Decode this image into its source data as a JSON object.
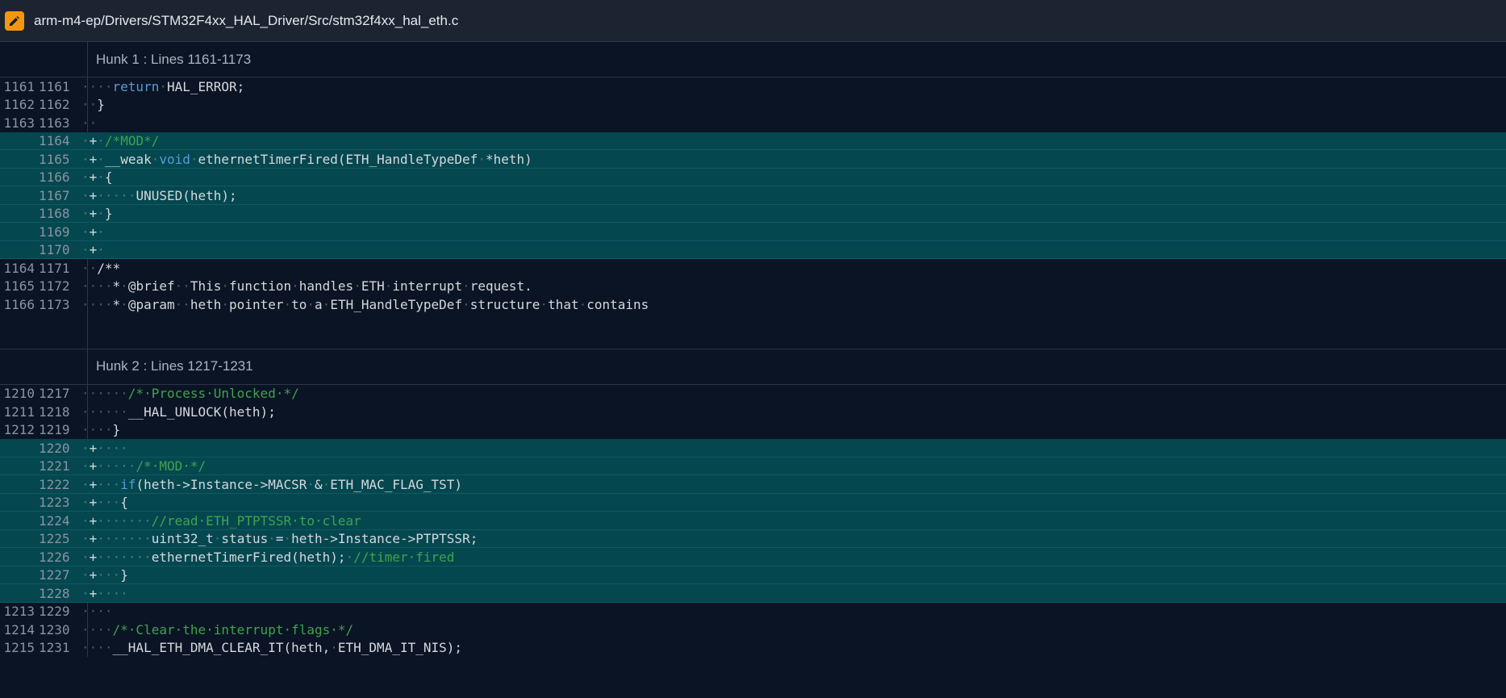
{
  "header": {
    "icon": "pencil-icon",
    "icon_color": "#f4970f",
    "path": "arm-m4-ep/Drivers/STM32F4xx_HAL_Driver/Src/stm32f4xx_hal_eth.c"
  },
  "hunks": [
    {
      "title": "Hunk 1 : Lines 1161-1173",
      "rows": [
        {
          "old": "1161",
          "new": "1161",
          "type": "ctx",
          "segs": [
            [
              "ws",
              "····"
            ],
            [
              "kw",
              "return"
            ],
            [
              "ws",
              "·"
            ],
            [
              "t",
              "HAL_ERROR;"
            ]
          ]
        },
        {
          "old": "1162",
          "new": "1162",
          "type": "ctx",
          "segs": [
            [
              "ws",
              "··"
            ],
            [
              "t",
              "}"
            ]
          ]
        },
        {
          "old": "1163",
          "new": "1163",
          "type": "ctx",
          "segs": [
            [
              "ws",
              "··"
            ]
          ]
        },
        {
          "old": "",
          "new": "1164",
          "type": "add",
          "segs": [
            [
              "ws",
              "·"
            ],
            [
              "t",
              "+"
            ],
            [
              "ws",
              "·"
            ],
            [
              "cm",
              "/*MOD*/"
            ]
          ]
        },
        {
          "old": "",
          "new": "1165",
          "type": "add",
          "segs": [
            [
              "ws",
              "·"
            ],
            [
              "t",
              "+"
            ],
            [
              "ws",
              "·"
            ],
            [
              "t",
              "__weak"
            ],
            [
              "ws",
              "·"
            ],
            [
              "kw",
              "void"
            ],
            [
              "ws",
              "·"
            ],
            [
              "t",
              "ethernetTimerFired(ETH_HandleTypeDef"
            ],
            [
              "ws",
              "·"
            ],
            [
              "t",
              "*heth)"
            ]
          ]
        },
        {
          "old": "",
          "new": "1166",
          "type": "add",
          "segs": [
            [
              "ws",
              "·"
            ],
            [
              "t",
              "+"
            ],
            [
              "ws",
              "·"
            ],
            [
              "t",
              "{"
            ]
          ]
        },
        {
          "old": "",
          "new": "1167",
          "type": "add",
          "segs": [
            [
              "ws",
              "·"
            ],
            [
              "t",
              "+"
            ],
            [
              "ws",
              "·····"
            ],
            [
              "t",
              "UNUSED(heth);"
            ]
          ]
        },
        {
          "old": "",
          "new": "1168",
          "type": "add",
          "segs": [
            [
              "ws",
              "·"
            ],
            [
              "t",
              "+"
            ],
            [
              "ws",
              "·"
            ],
            [
              "t",
              "}"
            ]
          ]
        },
        {
          "old": "",
          "new": "1169",
          "type": "add",
          "segs": [
            [
              "ws",
              "·"
            ],
            [
              "t",
              "+"
            ],
            [
              "ws",
              "·"
            ]
          ]
        },
        {
          "old": "",
          "new": "1170",
          "type": "add",
          "segs": [
            [
              "ws",
              "·"
            ],
            [
              "t",
              "+"
            ],
            [
              "ws",
              "·"
            ]
          ]
        },
        {
          "old": "1164",
          "new": "1171",
          "type": "ctx",
          "segs": [
            [
              "ws",
              "··"
            ],
            [
              "t",
              "/**"
            ]
          ]
        },
        {
          "old": "1165",
          "new": "1172",
          "type": "ctx",
          "segs": [
            [
              "ws",
              "····"
            ],
            [
              "t",
              "*"
            ],
            [
              "ws",
              "·"
            ],
            [
              "t",
              "@brief"
            ],
            [
              "ws",
              "··"
            ],
            [
              "t",
              "This"
            ],
            [
              "ws",
              "·"
            ],
            [
              "t",
              "function"
            ],
            [
              "ws",
              "·"
            ],
            [
              "t",
              "handles"
            ],
            [
              "ws",
              "·"
            ],
            [
              "t",
              "ETH"
            ],
            [
              "ws",
              "·"
            ],
            [
              "t",
              "interrupt"
            ],
            [
              "ws",
              "·"
            ],
            [
              "t",
              "request."
            ]
          ]
        },
        {
          "old": "1166",
          "new": "1173",
          "type": "ctx",
          "segs": [
            [
              "ws",
              "····"
            ],
            [
              "t",
              "*"
            ],
            [
              "ws",
              "·"
            ],
            [
              "t",
              "@param"
            ],
            [
              "ws",
              "··"
            ],
            [
              "t",
              "heth"
            ],
            [
              "ws",
              "·"
            ],
            [
              "t",
              "pointer"
            ],
            [
              "ws",
              "·"
            ],
            [
              "t",
              "to"
            ],
            [
              "ws",
              "·"
            ],
            [
              "t",
              "a"
            ],
            [
              "ws",
              "·"
            ],
            [
              "t",
              "ETH_HandleTypeDef"
            ],
            [
              "ws",
              "·"
            ],
            [
              "t",
              "structure"
            ],
            [
              "ws",
              "·"
            ],
            [
              "t",
              "that"
            ],
            [
              "ws",
              "·"
            ],
            [
              "t",
              "contains"
            ]
          ]
        }
      ]
    },
    {
      "title": "Hunk 2 : Lines 1217-1231",
      "rows": [
        {
          "old": "1210",
          "new": "1217",
          "type": "ctx",
          "segs": [
            [
              "ws",
              "······"
            ],
            [
              "cm",
              "/*·Process·Unlocked·*/"
            ]
          ]
        },
        {
          "old": "1211",
          "new": "1218",
          "type": "ctx",
          "segs": [
            [
              "ws",
              "······"
            ],
            [
              "t",
              "__HAL_UNLOCK(heth);"
            ]
          ]
        },
        {
          "old": "1212",
          "new": "1219",
          "type": "ctx",
          "segs": [
            [
              "ws",
              "····"
            ],
            [
              "t",
              "}"
            ]
          ]
        },
        {
          "old": "",
          "new": "1220",
          "type": "add",
          "segs": [
            [
              "ws",
              "·"
            ],
            [
              "t",
              "+"
            ],
            [
              "ws",
              "····"
            ]
          ]
        },
        {
          "old": "",
          "new": "1221",
          "type": "add",
          "segs": [
            [
              "ws",
              "·"
            ],
            [
              "t",
              "+"
            ],
            [
              "ws",
              "·····"
            ],
            [
              "cm",
              "/*·MOD·*/"
            ]
          ]
        },
        {
          "old": "",
          "new": "1222",
          "type": "add",
          "segs": [
            [
              "ws",
              "·"
            ],
            [
              "t",
              "+"
            ],
            [
              "ws",
              "···"
            ],
            [
              "kw",
              "if"
            ],
            [
              "t",
              "(heth->Instance->MACSR"
            ],
            [
              "ws",
              "·"
            ],
            [
              "t",
              "&"
            ],
            [
              "ws",
              "·"
            ],
            [
              "t",
              "ETH_MAC_FLAG_TST)"
            ]
          ]
        },
        {
          "old": "",
          "new": "1223",
          "type": "add",
          "segs": [
            [
              "ws",
              "·"
            ],
            [
              "t",
              "+"
            ],
            [
              "ws",
              "···"
            ],
            [
              "t",
              "{"
            ]
          ]
        },
        {
          "old": "",
          "new": "1224",
          "type": "add",
          "segs": [
            [
              "ws",
              "·"
            ],
            [
              "t",
              "+"
            ],
            [
              "ws",
              "·······"
            ],
            [
              "cm",
              "//read·ETH_PTPTSSR·to·clear"
            ]
          ]
        },
        {
          "old": "",
          "new": "1225",
          "type": "add",
          "segs": [
            [
              "ws",
              "·"
            ],
            [
              "t",
              "+"
            ],
            [
              "ws",
              "·······"
            ],
            [
              "t",
              "uint32_t"
            ],
            [
              "ws",
              "·"
            ],
            [
              "t",
              "status"
            ],
            [
              "ws",
              "·"
            ],
            [
              "t",
              "="
            ],
            [
              "ws",
              "·"
            ],
            [
              "t",
              "heth->Instance->PTPTSSR;"
            ]
          ]
        },
        {
          "old": "",
          "new": "1226",
          "type": "add",
          "segs": [
            [
              "ws",
              "·"
            ],
            [
              "t",
              "+"
            ],
            [
              "ws",
              "·······"
            ],
            [
              "t",
              "ethernetTimerFired(heth);"
            ],
            [
              "ws",
              "·"
            ],
            [
              "cm",
              "//timer·fired"
            ]
          ]
        },
        {
          "old": "",
          "new": "1227",
          "type": "add",
          "segs": [
            [
              "ws",
              "·"
            ],
            [
              "t",
              "+"
            ],
            [
              "ws",
              "···"
            ],
            [
              "t",
              "}"
            ]
          ]
        },
        {
          "old": "",
          "new": "1228",
          "type": "add",
          "segs": [
            [
              "ws",
              "·"
            ],
            [
              "t",
              "+"
            ],
            [
              "ws",
              "····"
            ]
          ]
        },
        {
          "old": "1213",
          "new": "1229",
          "type": "ctx",
          "segs": [
            [
              "ws",
              "····"
            ]
          ]
        },
        {
          "old": "1214",
          "new": "1230",
          "type": "ctx",
          "segs": [
            [
              "ws",
              "····"
            ],
            [
              "cm",
              "/*·Clear·the·interrupt·flags·*/"
            ]
          ]
        },
        {
          "old": "1215",
          "new": "1231",
          "type": "ctx",
          "segs": [
            [
              "ws",
              "····"
            ],
            [
              "t",
              "__HAL_ETH_DMA_CLEAR_IT(heth,"
            ],
            [
              "ws",
              "·"
            ],
            [
              "t",
              "ETH_DMA_IT_NIS);"
            ]
          ]
        }
      ]
    }
  ]
}
